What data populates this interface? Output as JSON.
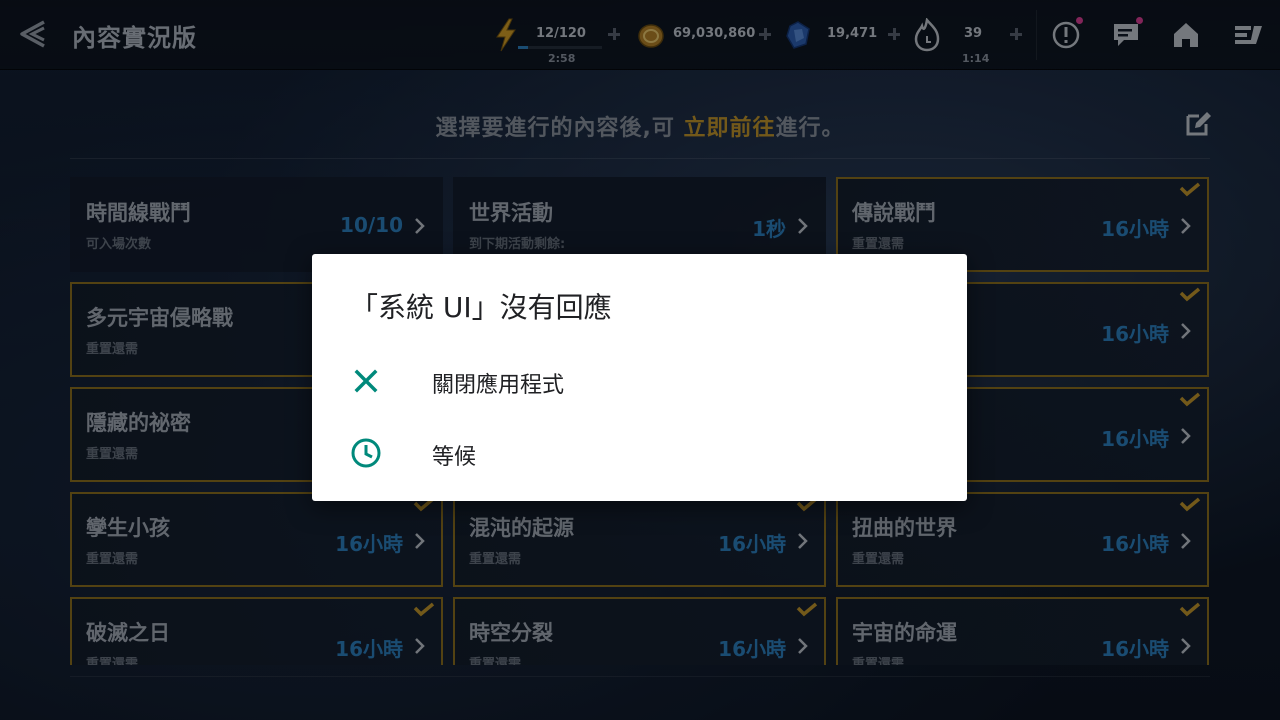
{
  "header": {
    "title": "內容實況版"
  },
  "resources": [
    {
      "name": "energy",
      "icon": "lightning-icon",
      "value": "12/120",
      "timer": "2:58"
    },
    {
      "name": "gold",
      "icon": "gold-coin-icon",
      "value": "69,030,860"
    },
    {
      "name": "crystal",
      "icon": "blue-crystal-icon",
      "value": "19,471"
    },
    {
      "name": "stamina",
      "icon": "flame-clock-icon",
      "value": "39",
      "timer": "1:14"
    }
  ],
  "top_icons": [
    "alert-icon",
    "chat-icon",
    "home-icon",
    "menu-icon"
  ],
  "instruction": {
    "before": "選擇要進行的內容後,可 ",
    "highlight": "立即前往",
    "after": "進行。"
  },
  "cards": [
    {
      "title": "時間線戰鬥",
      "sub": "可入場次數",
      "value": "10/10",
      "checked": false
    },
    {
      "title": "世界活動",
      "sub": "到下期活動剩餘:",
      "value": "1秒",
      "checked": false
    },
    {
      "title": "傳說戰鬥",
      "sub": "重置還需",
      "value": "16小時",
      "checked": true
    },
    {
      "title": "多元宇宙侵略戰",
      "sub": "重置還需",
      "value": "",
      "checked": true
    },
    {
      "title": "",
      "sub": "",
      "value": "",
      "checked": true
    },
    {
      "title": "",
      "sub": "",
      "value": "16小時",
      "checked": true
    },
    {
      "title": "隱藏的祕密",
      "sub": "重置還需",
      "value": "",
      "checked": true
    },
    {
      "title": "",
      "sub": "",
      "value": "",
      "checked": true
    },
    {
      "title": "",
      "sub": "",
      "value": "16小時",
      "checked": true
    },
    {
      "title": "孿生小孩",
      "sub": "重置還需",
      "value": "16小時",
      "checked": true
    },
    {
      "title": "混沌的起源",
      "sub": "重置還需",
      "value": "16小時",
      "checked": true
    },
    {
      "title": "扭曲的世界",
      "sub": "重置還需",
      "value": "16小時",
      "checked": true
    },
    {
      "title": "破滅之日",
      "sub": "重置還需",
      "value": "16小時",
      "checked": true
    },
    {
      "title": "時空分裂",
      "sub": "重置還需",
      "value": "16小時",
      "checked": true
    },
    {
      "title": "宇宙的命運",
      "sub": "重置還需",
      "value": "16小時",
      "checked": true
    }
  ],
  "dialog": {
    "title": "「系統 UI」沒有回應",
    "options": [
      {
        "icon": "close-icon",
        "label": "關閉應用程式"
      },
      {
        "icon": "clock-icon",
        "label": "等候"
      }
    ],
    "accent": "#00897b"
  },
  "colors": {
    "gold": "#c79a2e",
    "blue_value": "#2d83c4"
  }
}
